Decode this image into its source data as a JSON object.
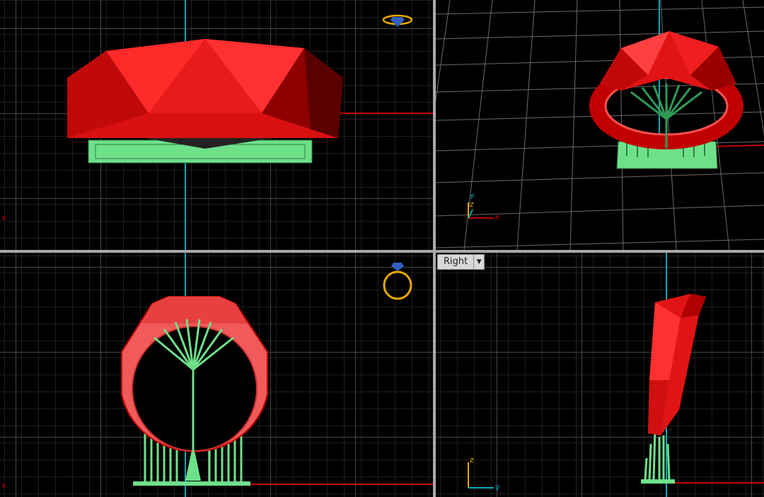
{
  "viewports": {
    "top": {
      "x_label": "x"
    },
    "perspective": {
      "axis_x": "x",
      "axis_y": "y",
      "axis_z": "z"
    },
    "front": {
      "x_label": "x"
    },
    "right": {
      "title": "Right",
      "dropdown_glyph": "▼",
      "axis_z": "z",
      "axis_y": "y"
    }
  },
  "colors": {
    "ring": "#e01414",
    "ring_light": "#ff3a3a",
    "ring_dark": "#7a0000",
    "support": "#6fe08a",
    "support_dark": "#2e7d4a",
    "grid": "#5a5a5a",
    "grid_major": "#8a8a8a",
    "axis_x": "#c00000",
    "axis_y": "#00b0c0",
    "nav_icon": "#e8a800"
  }
}
